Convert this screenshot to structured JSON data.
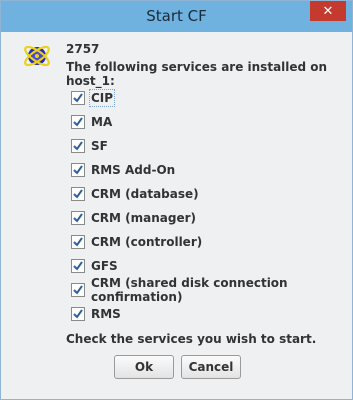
{
  "window": {
    "title": "Start CF",
    "close_label": "✕"
  },
  "message": {
    "code": "2757",
    "text": "The following services are installed on host_1:"
  },
  "services": [
    {
      "label": "CIP",
      "checked": true
    },
    {
      "label": "MA",
      "checked": true
    },
    {
      "label": "SF",
      "checked": true
    },
    {
      "label": "RMS Add-On",
      "checked": true
    },
    {
      "label": "CRM (database)",
      "checked": true
    },
    {
      "label": "CRM (manager)",
      "checked": true
    },
    {
      "label": "CRM (controller)",
      "checked": true
    },
    {
      "label": "GFS",
      "checked": true
    },
    {
      "label": "CRM (shared disk connection confirmation)",
      "checked": true
    },
    {
      "label": "RMS",
      "checked": true
    }
  ],
  "hint": "Check the services you wish to start.",
  "buttons": {
    "ok": "Ok",
    "cancel": "Cancel"
  },
  "colors": {
    "titlebar": "#6fb1df",
    "close": "#c43a2e",
    "check": "#2f5f9e",
    "focus": "#7aa7d6"
  }
}
